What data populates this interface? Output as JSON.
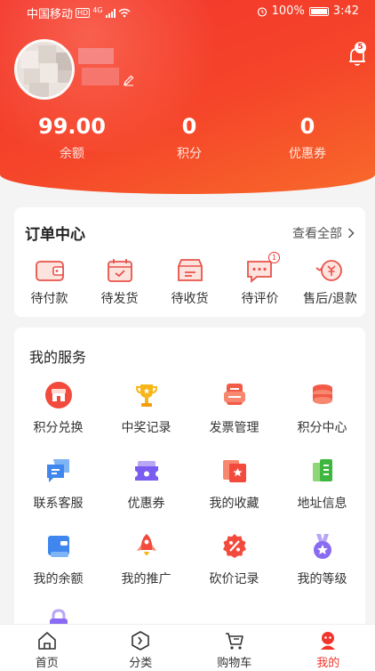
{
  "status_bar": {
    "carrier": "中国移动",
    "hd": "HD",
    "network": "4G",
    "battery": "100%",
    "time": "3:42"
  },
  "header": {
    "notification_count": "5",
    "stats": [
      {
        "value": "99.00",
        "label": "余额"
      },
      {
        "value": "0",
        "label": "积分"
      },
      {
        "value": "0",
        "label": "优惠券"
      }
    ]
  },
  "orders": {
    "title": "订单中心",
    "view_all": "查看全部",
    "items": [
      {
        "label": "待付款",
        "icon": "wallet-icon"
      },
      {
        "label": "待发货",
        "icon": "calendar-box-icon"
      },
      {
        "label": "待收货",
        "icon": "package-icon"
      },
      {
        "label": "待评价",
        "icon": "comment-icon",
        "badge": "1"
      },
      {
        "label": "售后/退款",
        "icon": "refund-icon"
      }
    ]
  },
  "services": {
    "title": "我的服务",
    "items": [
      {
        "label": "积分兑换",
        "icon": "shop-icon"
      },
      {
        "label": "中奖记录",
        "icon": "trophy-icon"
      },
      {
        "label": "发票管理",
        "icon": "invoice-icon"
      },
      {
        "label": "积分中心",
        "icon": "coins-icon"
      },
      {
        "label": "联系客服",
        "icon": "chat-icon"
      },
      {
        "label": "优惠券",
        "icon": "ticket-icon"
      },
      {
        "label": "我的收藏",
        "icon": "favorite-icon"
      },
      {
        "label": "地址信息",
        "icon": "address-icon"
      },
      {
        "label": "我的余额",
        "icon": "balance-icon"
      },
      {
        "label": "我的推广",
        "icon": "rocket-icon"
      },
      {
        "label": "砍价记录",
        "icon": "discount-icon"
      },
      {
        "label": "我的等级",
        "icon": "medal-icon"
      }
    ]
  },
  "tabbar": {
    "items": [
      {
        "label": "首页",
        "icon": "home-icon"
      },
      {
        "label": "分类",
        "icon": "category-icon"
      },
      {
        "label": "购物车",
        "icon": "cart-icon"
      },
      {
        "label": "我的",
        "icon": "profile-icon"
      }
    ]
  },
  "colors": {
    "brand": "#f2352c",
    "header_gradient_end": "#f86a2a",
    "background": "#f4f4f4"
  }
}
